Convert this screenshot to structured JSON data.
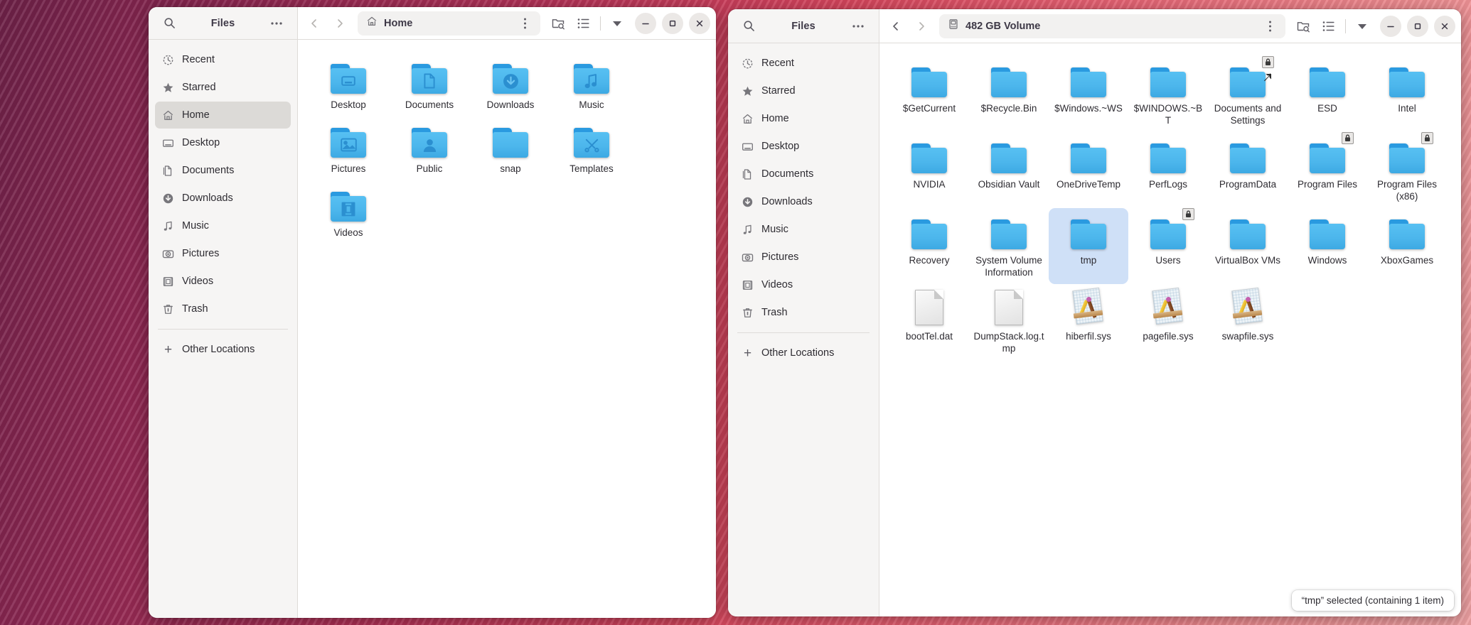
{
  "windows": [
    {
      "app_title": "Files",
      "path_label": "Home",
      "path_icon": "home-icon",
      "sidebar": [
        {
          "label": "Recent",
          "icon": "recent-clock-icon",
          "selected": false
        },
        {
          "label": "Starred",
          "icon": "star-icon",
          "selected": false
        },
        {
          "label": "Home",
          "icon": "home-icon",
          "selected": true
        },
        {
          "label": "Desktop",
          "icon": "desktop-icon",
          "selected": false
        },
        {
          "label": "Documents",
          "icon": "documents-icon",
          "selected": false
        },
        {
          "label": "Downloads",
          "icon": "download-icon",
          "selected": false
        },
        {
          "label": "Music",
          "icon": "music-note-icon",
          "selected": false
        },
        {
          "label": "Pictures",
          "icon": "camera-icon",
          "selected": false
        },
        {
          "label": "Videos",
          "icon": "film-icon",
          "selected": false
        },
        {
          "label": "Trash",
          "icon": "trash-icon",
          "selected": false
        }
      ],
      "sidebar_other": {
        "label": "Other Locations",
        "icon": "plus-icon"
      },
      "files": [
        {
          "name": "Desktop",
          "type": "folder",
          "glyph": "desktop-glyph",
          "selected": false
        },
        {
          "name": "Documents",
          "type": "folder",
          "glyph": "document-glyph",
          "selected": false
        },
        {
          "name": "Downloads",
          "type": "folder",
          "glyph": "download-glyph",
          "selected": false
        },
        {
          "name": "Music",
          "type": "folder",
          "glyph": "music-glyph",
          "selected": false
        },
        {
          "name": "Pictures",
          "type": "folder",
          "glyph": "picture-glyph",
          "selected": false
        },
        {
          "name": "Public",
          "type": "folder",
          "glyph": "person-glyph",
          "selected": false
        },
        {
          "name": "snap",
          "type": "folder",
          "glyph": "",
          "selected": false
        },
        {
          "name": "Templates",
          "type": "folder",
          "glyph": "tools-glyph",
          "selected": false
        },
        {
          "name": "Videos",
          "type": "folder",
          "glyph": "film-glyph",
          "selected": false
        }
      ],
      "status": ""
    },
    {
      "app_title": "Files",
      "path_label": "482 GB Volume",
      "path_icon": "drive-icon",
      "sidebar": [
        {
          "label": "Recent",
          "icon": "recent-clock-icon",
          "selected": false
        },
        {
          "label": "Starred",
          "icon": "star-icon",
          "selected": false
        },
        {
          "label": "Home",
          "icon": "home-icon",
          "selected": false
        },
        {
          "label": "Desktop",
          "icon": "desktop-icon",
          "selected": false
        },
        {
          "label": "Documents",
          "icon": "documents-icon",
          "selected": false
        },
        {
          "label": "Downloads",
          "icon": "download-icon",
          "selected": false
        },
        {
          "label": "Music",
          "icon": "music-note-icon",
          "selected": false
        },
        {
          "label": "Pictures",
          "icon": "camera-icon",
          "selected": false
        },
        {
          "label": "Videos",
          "icon": "film-icon",
          "selected": false
        },
        {
          "label": "Trash",
          "icon": "trash-icon",
          "selected": false
        }
      ],
      "sidebar_other": {
        "label": "Other Locations",
        "icon": "plus-icon"
      },
      "files": [
        {
          "name": "$GetCurrent",
          "type": "folder",
          "glyph": "",
          "selected": false,
          "badges": []
        },
        {
          "name": "$Recycle.Bin",
          "type": "folder",
          "glyph": "",
          "selected": false,
          "badges": []
        },
        {
          "name": "$Windows.~WS",
          "type": "folder",
          "glyph": "",
          "selected": false,
          "badges": []
        },
        {
          "name": "$WINDOWS.~BT",
          "type": "folder",
          "glyph": "",
          "selected": false,
          "badges": []
        },
        {
          "name": "Documents and Settings",
          "type": "folder",
          "glyph": "",
          "selected": false,
          "badges": [
            "lock",
            "link"
          ]
        },
        {
          "name": "ESD",
          "type": "folder",
          "glyph": "",
          "selected": false,
          "badges": []
        },
        {
          "name": "Intel",
          "type": "folder",
          "glyph": "",
          "selected": false,
          "badges": []
        },
        {
          "name": "NVIDIA",
          "type": "folder",
          "glyph": "",
          "selected": false,
          "badges": []
        },
        {
          "name": "Obsidian Vault",
          "type": "folder",
          "glyph": "",
          "selected": false,
          "badges": []
        },
        {
          "name": "OneDriveTemp",
          "type": "folder",
          "glyph": "",
          "selected": false,
          "badges": []
        },
        {
          "name": "PerfLogs",
          "type": "folder",
          "glyph": "",
          "selected": false,
          "badges": []
        },
        {
          "name": "ProgramData",
          "type": "folder",
          "glyph": "",
          "selected": false,
          "badges": []
        },
        {
          "name": "Program Files",
          "type": "folder",
          "glyph": "",
          "selected": false,
          "badges": [
            "lock"
          ]
        },
        {
          "name": "Program Files (x86)",
          "type": "folder",
          "glyph": "",
          "selected": false,
          "badges": [
            "lock"
          ]
        },
        {
          "name": "Recovery",
          "type": "folder",
          "glyph": "",
          "selected": false,
          "badges": []
        },
        {
          "name": "System Volume Information",
          "type": "folder",
          "glyph": "",
          "selected": false,
          "badges": []
        },
        {
          "name": "tmp",
          "type": "folder",
          "glyph": "",
          "selected": true,
          "badges": []
        },
        {
          "name": "Users",
          "type": "folder",
          "glyph": "",
          "selected": false,
          "badges": [
            "lock"
          ]
        },
        {
          "name": "VirtualBox VMs",
          "type": "folder",
          "glyph": "",
          "selected": false,
          "badges": []
        },
        {
          "name": "Windows",
          "type": "folder",
          "glyph": "",
          "selected": false,
          "badges": []
        },
        {
          "name": "XboxGames",
          "type": "folder",
          "glyph": "",
          "selected": false,
          "badges": []
        },
        {
          "name": "bootTel.dat",
          "type": "file",
          "glyph": "",
          "selected": false,
          "badges": []
        },
        {
          "name": "DumpStack.log.tmp",
          "type": "file",
          "glyph": "",
          "selected": false,
          "badges": []
        },
        {
          "name": "hiberfil.sys",
          "type": "sysfile",
          "glyph": "",
          "selected": false,
          "badges": []
        },
        {
          "name": "pagefile.sys",
          "type": "sysfile",
          "glyph": "",
          "selected": false,
          "badges": []
        },
        {
          "name": "swapfile.sys",
          "type": "sysfile",
          "glyph": "",
          "selected": false,
          "badges": []
        }
      ],
      "status": "“tmp” selected  (containing 1 item)"
    }
  ],
  "toolbar_icons": {
    "search": "search-icon",
    "menu": "ellipsis-icon",
    "back": "chevron-left-icon",
    "forward": "chevron-right-icon",
    "options": "vertical-ellipsis-icon",
    "search_folder": "folder-search-icon",
    "view_list": "list-view-icon",
    "view_dropdown": "chevron-down-icon",
    "minimize": "minimize-icon",
    "maximize": "maximize-icon",
    "close": "close-icon"
  },
  "colors": {
    "folder_blue": "#4cb6ec",
    "selection_blue": "#cfe0f7",
    "sidebar_bg": "#f6f5f4",
    "header_bg": "#f6f5f4"
  }
}
